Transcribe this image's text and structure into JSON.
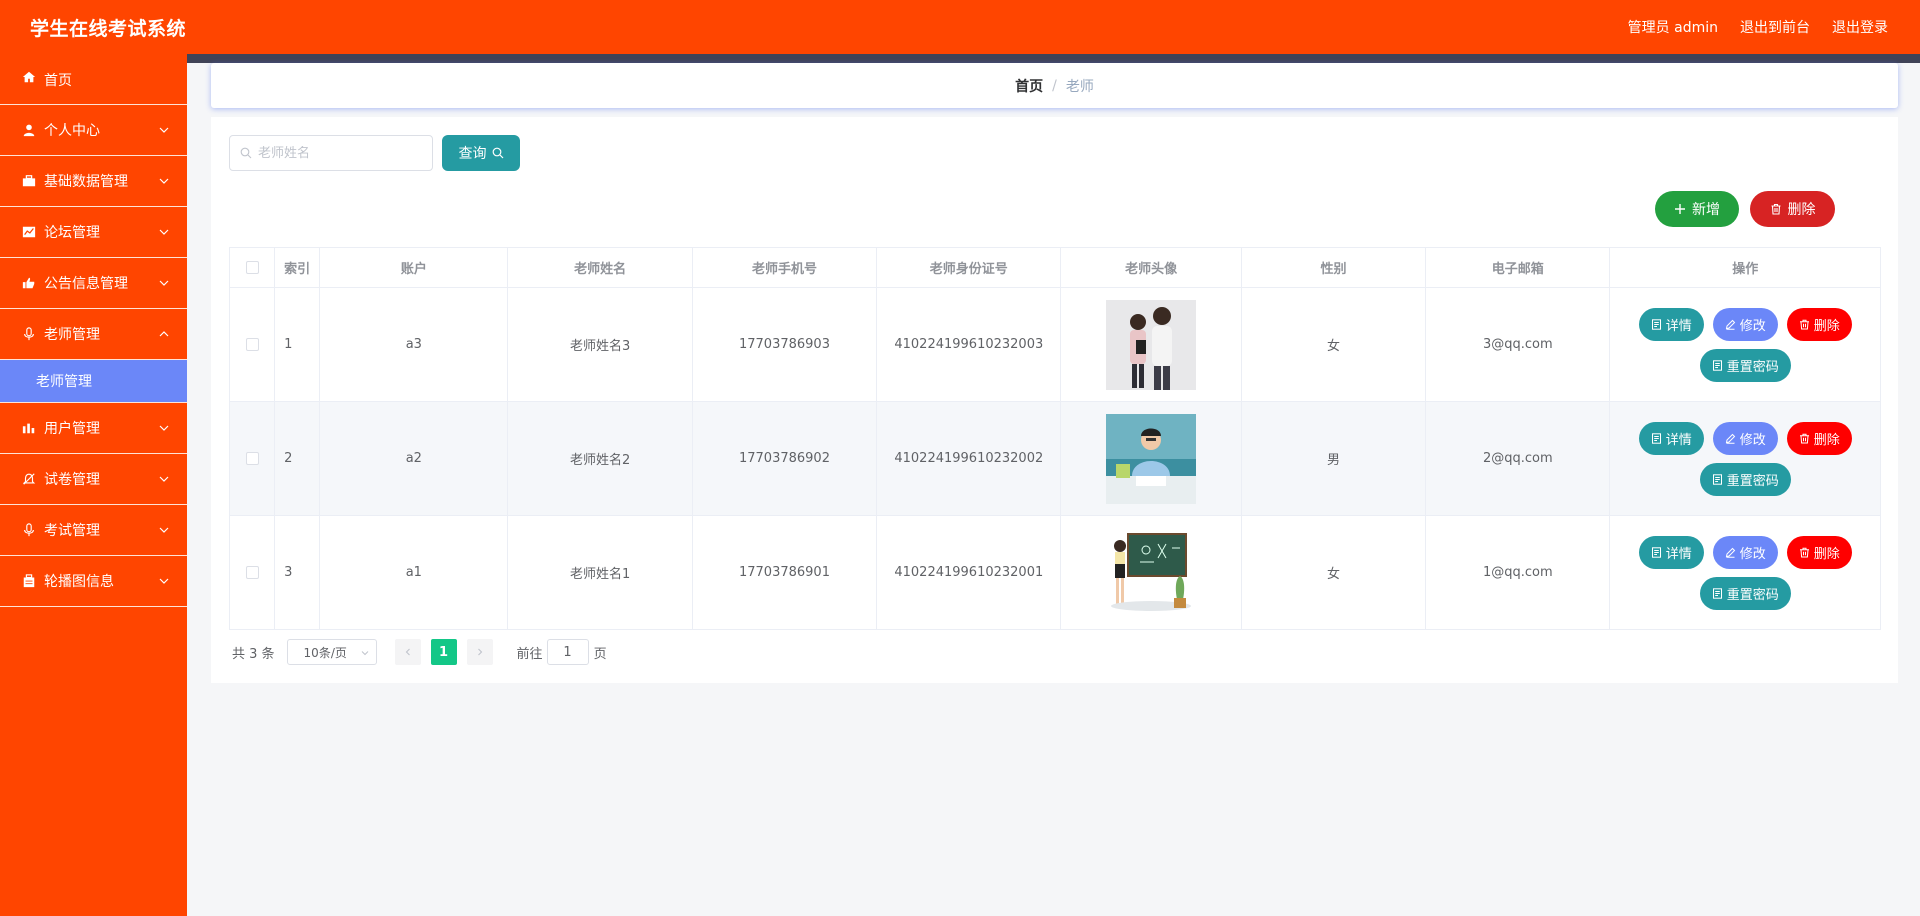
{
  "header": {
    "title": "学生在线考试系统",
    "admin_label": "管理员 admin",
    "front_label": "退出到前台",
    "logout_label": "退出登录"
  },
  "sidebar": {
    "items": [
      {
        "label": "首页",
        "icon": "home-icon"
      },
      {
        "label": "个人中心",
        "icon": "user-icon"
      },
      {
        "label": "基础数据管理",
        "icon": "briefcase-icon"
      },
      {
        "label": "论坛管理",
        "icon": "chart-icon"
      },
      {
        "label": "公告信息管理",
        "icon": "thumb-icon"
      },
      {
        "label": "老师管理",
        "icon": "mic-icon"
      },
      {
        "label": "用户管理",
        "icon": "bars-icon"
      },
      {
        "label": "试卷管理",
        "icon": "bell-off-icon"
      },
      {
        "label": "考试管理",
        "icon": "mic-icon"
      },
      {
        "label": "轮播图信息",
        "icon": "bag-icon"
      }
    ],
    "active_sub": "老师管理"
  },
  "breadcrumb": {
    "home": "首页",
    "separator": "/",
    "current": "老师"
  },
  "search": {
    "placeholder": "老师姓名",
    "query_label": "查询"
  },
  "actions": {
    "add_label": "新增",
    "delete_label": "删除"
  },
  "table": {
    "columns": [
      "索引",
      "账户",
      "老师姓名",
      "老师手机号",
      "老师身份证号",
      "老师头像",
      "性别",
      "电子邮箱",
      "操作"
    ],
    "rows": [
      {
        "index": "1",
        "account": "a3",
        "name": "老师姓名3",
        "phone": "17703786903",
        "id_card": "410224199610232003",
        "gender": "女",
        "email": "3@qq.com"
      },
      {
        "index": "2",
        "account": "a2",
        "name": "老师姓名2",
        "phone": "17703786902",
        "id_card": "410224199610232002",
        "gender": "男",
        "email": "2@qq.com"
      },
      {
        "index": "3",
        "account": "a1",
        "name": "老师姓名1",
        "phone": "17703786901",
        "id_card": "410224199610232001",
        "gender": "女",
        "email": "1@qq.com"
      }
    ],
    "row_actions": {
      "detail": "详情",
      "edit": "修改",
      "remove": "删除",
      "reset": "重置密码"
    }
  },
  "pagination": {
    "total": "共 3 条",
    "page_size": "10条/页",
    "current_page": "1",
    "goto_prefix": "前往",
    "goto_value": "1",
    "goto_suffix": "页"
  },
  "colors": {
    "brand": "#ff4500",
    "active_sub": "#6b87f8",
    "teal": "#259ba2",
    "green": "#23a03f",
    "danger": "#d72323",
    "page_active": "#13c787"
  }
}
